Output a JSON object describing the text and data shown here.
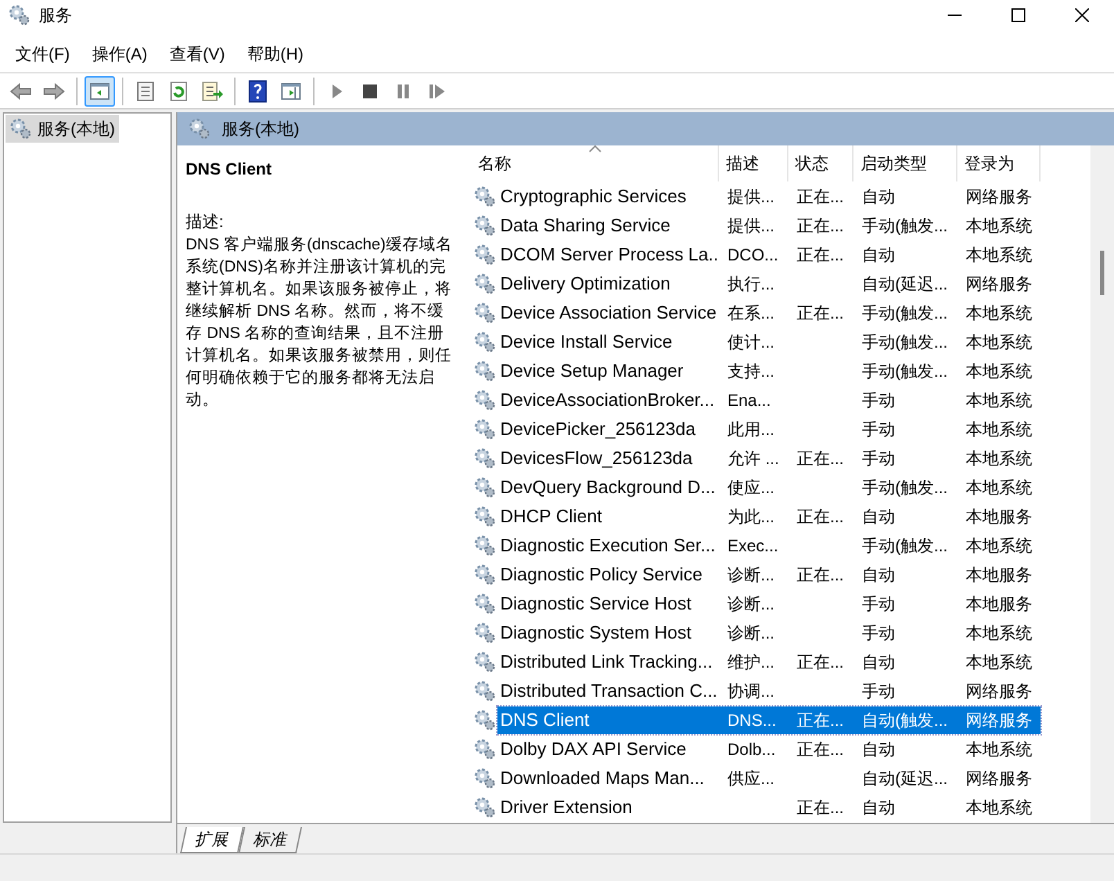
{
  "window": {
    "title": "服务"
  },
  "menu": [
    "文件(F)",
    "操作(A)",
    "查看(V)",
    "帮助(H)"
  ],
  "toolbar": [
    [
      {
        "kind": "back",
        "selected": false
      },
      {
        "kind": "forward",
        "selected": false
      }
    ],
    [
      {
        "kind": "tree",
        "selected": true
      }
    ],
    [
      {
        "kind": "properties",
        "selected": false
      },
      {
        "kind": "refresh",
        "selected": false
      },
      {
        "kind": "export",
        "selected": false
      }
    ],
    [
      {
        "kind": "help",
        "selected": false
      },
      {
        "kind": "actionpane",
        "selected": false
      }
    ],
    [
      {
        "kind": "play",
        "selected": false
      },
      {
        "kind": "stop",
        "selected": false
      },
      {
        "kind": "pause",
        "selected": false
      },
      {
        "kind": "resume",
        "selected": false
      }
    ]
  ],
  "tree": {
    "items": [
      {
        "label": "服务(本地)",
        "selected": true
      }
    ]
  },
  "pane_header": {
    "title": "服务(本地)"
  },
  "details": {
    "service_name": "DNS Client",
    "description_label": "描述:",
    "description": "DNS 客户端服务(dnscache)缓存域名系统(DNS)名称并注册该计算机的完整计算机名。如果该服务被停止，将继续解析 DNS 名称。然而，将不缓存 DNS 名称的查询结果，且不注册计算机名。如果该服务被禁用，则任何明确依赖于它的服务都将无法启动。"
  },
  "table": {
    "columns": [
      "名称",
      "描述",
      "状态",
      "启动类型",
      "登录为"
    ],
    "rows": [
      {
        "name": "Cryptographic Services",
        "description": "提供...",
        "status": "正在...",
        "startup": "自动",
        "logon": "网络服务",
        "selected": false
      },
      {
        "name": "Data Sharing Service",
        "description": "提供...",
        "status": "正在...",
        "startup": "手动(触发...",
        "logon": "本地系统",
        "selected": false
      },
      {
        "name": "DCOM Server Process La...",
        "description": "DCO...",
        "status": "正在...",
        "startup": "自动",
        "logon": "本地系统",
        "selected": false
      },
      {
        "name": "Delivery Optimization",
        "description": "执行...",
        "status": "",
        "startup": "自动(延迟...",
        "logon": "网络服务",
        "selected": false
      },
      {
        "name": "Device Association Service",
        "description": "在系...",
        "status": "正在...",
        "startup": "手动(触发...",
        "logon": "本地系统",
        "selected": false
      },
      {
        "name": "Device Install Service",
        "description": "使计...",
        "status": "",
        "startup": "手动(触发...",
        "logon": "本地系统",
        "selected": false
      },
      {
        "name": "Device Setup Manager",
        "description": "支持...",
        "status": "",
        "startup": "手动(触发...",
        "logon": "本地系统",
        "selected": false
      },
      {
        "name": "DeviceAssociationBroker...",
        "description": "Ena...",
        "status": "",
        "startup": "手动",
        "logon": "本地系统",
        "selected": false
      },
      {
        "name": "DevicePicker_256123da",
        "description": "此用...",
        "status": "",
        "startup": "手动",
        "logon": "本地系统",
        "selected": false
      },
      {
        "name": "DevicesFlow_256123da",
        "description": "允许 ...",
        "status": "正在...",
        "startup": "手动",
        "logon": "本地系统",
        "selected": false
      },
      {
        "name": "DevQuery Background D...",
        "description": "使应...",
        "status": "",
        "startup": "手动(触发...",
        "logon": "本地系统",
        "selected": false
      },
      {
        "name": "DHCP Client",
        "description": "为此...",
        "status": "正在...",
        "startup": "自动",
        "logon": "本地服务",
        "selected": false
      },
      {
        "name": "Diagnostic Execution Ser...",
        "description": "Exec...",
        "status": "",
        "startup": "手动(触发...",
        "logon": "本地系统",
        "selected": false
      },
      {
        "name": "Diagnostic Policy Service",
        "description": "诊断...",
        "status": "正在...",
        "startup": "自动",
        "logon": "本地服务",
        "selected": false
      },
      {
        "name": "Diagnostic Service Host",
        "description": "诊断...",
        "status": "",
        "startup": "手动",
        "logon": "本地服务",
        "selected": false
      },
      {
        "name": "Diagnostic System Host",
        "description": "诊断...",
        "status": "",
        "startup": "手动",
        "logon": "本地系统",
        "selected": false
      },
      {
        "name": "Distributed Link Tracking...",
        "description": "维护...",
        "status": "正在...",
        "startup": "自动",
        "logon": "本地系统",
        "selected": false
      },
      {
        "name": "Distributed Transaction C...",
        "description": "协调...",
        "status": "",
        "startup": "手动",
        "logon": "网络服务",
        "selected": false
      },
      {
        "name": "DNS Client",
        "description": "DNS...",
        "status": "正在...",
        "startup": "自动(触发...",
        "logon": "网络服务",
        "selected": true
      },
      {
        "name": "Dolby DAX API Service",
        "description": "Dolb...",
        "status": "正在...",
        "startup": "自动",
        "logon": "本地系统",
        "selected": false
      },
      {
        "name": "Downloaded Maps Man...",
        "description": "供应...",
        "status": "",
        "startup": "自动(延迟...",
        "logon": "网络服务",
        "selected": false
      },
      {
        "name": "Driver Extension",
        "description": "",
        "status": "正在...",
        "startup": "自动",
        "logon": "本地系统",
        "selected": false
      }
    ]
  },
  "tabs": [
    {
      "label": "扩展",
      "selected": true
    },
    {
      "label": "标准",
      "selected": false
    }
  ]
}
